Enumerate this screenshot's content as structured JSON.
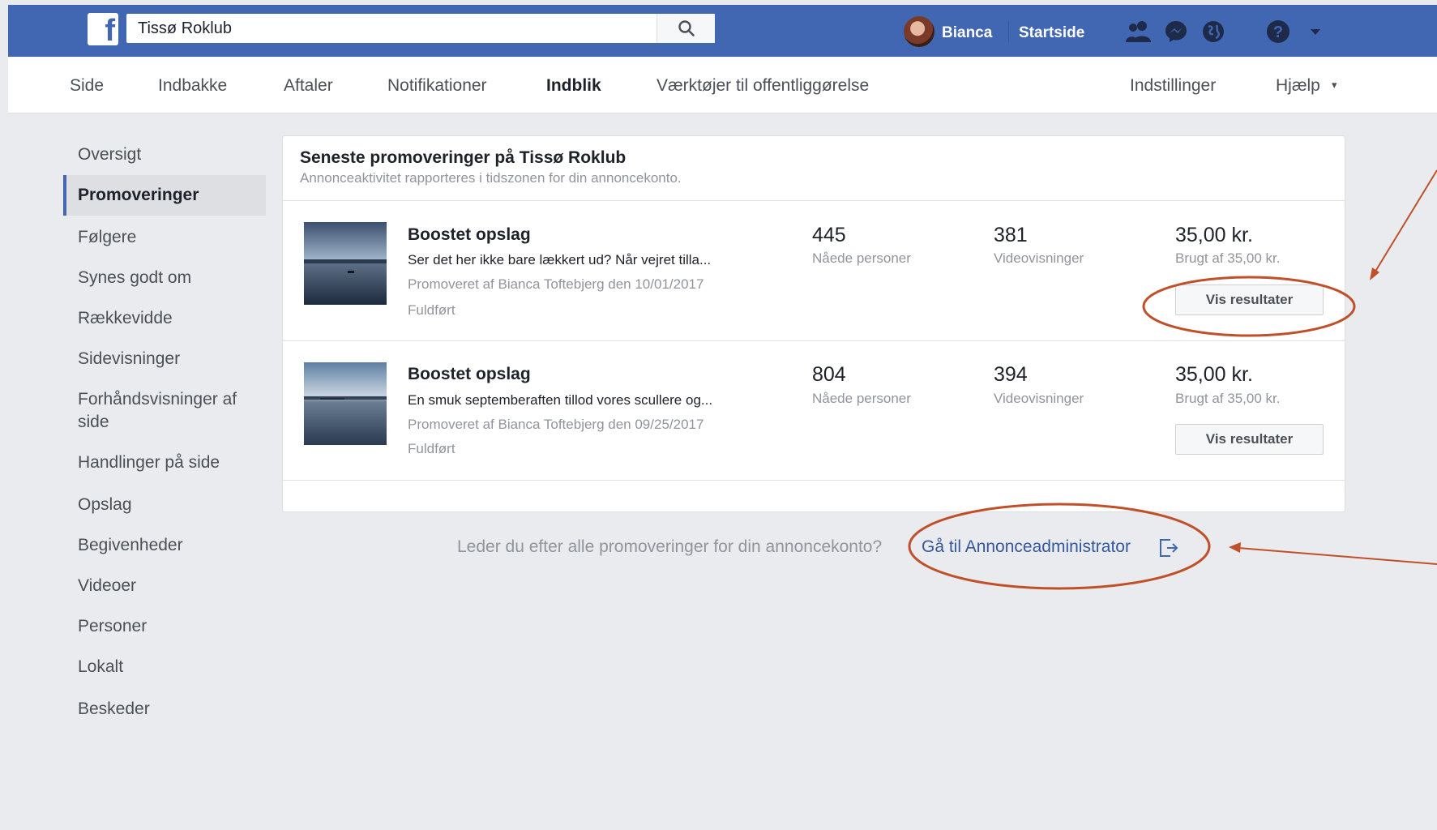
{
  "header": {
    "search_value": "Tissø Roklub",
    "user_name": "Bianca",
    "home_label": "Startside"
  },
  "subnav": {
    "tabs": [
      "Side",
      "Indbakke",
      "Aftaler",
      "Notifikationer",
      "Indblik",
      "Værktøjer til offentliggørelse"
    ],
    "settings": "Indstillinger",
    "help": "Hjælp",
    "help_caret": "▾"
  },
  "sidebar": {
    "items": [
      "Oversigt",
      "Promoveringer",
      "Følgere",
      "Synes godt om",
      "Rækkevidde",
      "Sidevisninger",
      "Forhåndsvisninger af side",
      "Handlinger på side",
      "Opslag",
      "Begivenheder",
      "Videoer",
      "Personer",
      "Lokalt",
      "Beskeder"
    ]
  },
  "card": {
    "title": "Seneste promoveringer på Tissø Roklub",
    "subtitle": "Annonceaktivitet rapporteres i tidszonen for din annoncekonto.",
    "rows": [
      {
        "title": "Boostet opslag",
        "description": "Ser det her ikke bare lækkert ud? Når vejret tilla...",
        "promoted_by": "Promoveret af Bianca Toftebjerg den 10/01/2017",
        "status": "Fuldført",
        "reached": "445",
        "reached_label": "Nåede personer",
        "views": "381",
        "views_label": "Videovisninger",
        "spent": "35,00 kr.",
        "spent_label": "Brugt af 35,00 kr.",
        "button": "Vis resultater"
      },
      {
        "title": "Boostet opslag",
        "description": "En smuk septemberaften tillod vores scullere og...",
        "promoted_by": "Promoveret af Bianca Toftebjerg den 09/25/2017",
        "status": "Fuldført",
        "reached": "804",
        "reached_label": "Nåede personer",
        "views": "394",
        "views_label": "Videovisninger",
        "spent": "35,00 kr.",
        "spent_label": "Brugt af 35,00 kr.",
        "button": "Vis resultater"
      }
    ]
  },
  "footer": {
    "question": "Leder du efter alle promoveringer for din annoncekonto?",
    "link": "Gå til Annonceadministrator"
  },
  "colors": {
    "brand": "#4267b2",
    "annotation": "#c0502a",
    "link": "#365899"
  }
}
